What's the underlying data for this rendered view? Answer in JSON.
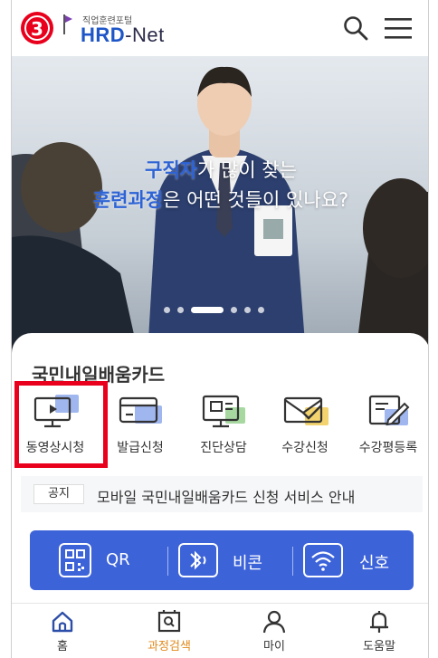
{
  "step_marker": "3",
  "header": {
    "logo_small": "직업훈련포털",
    "logo_hrd": "HRD",
    "logo_net": "-Net"
  },
  "hero": {
    "line1_highlight": "구직자",
    "line1_rest": "가 많이 찾는",
    "line2_highlight": "훈련과정",
    "line2_rest": "은 어떤 것들이 있나요?",
    "slide_count": 6,
    "active_slide": 3
  },
  "card_section": {
    "title": "국민내일배움카드",
    "items": [
      {
        "label": "동영상시청",
        "icon": "monitor-play-icon"
      },
      {
        "label": "발급신청",
        "icon": "card-icon"
      },
      {
        "label": "진단상담",
        "icon": "consult-monitor-icon"
      },
      {
        "label": "수강신청",
        "icon": "check-envelope-icon"
      },
      {
        "label": "수강평등록",
        "icon": "edit-review-icon"
      }
    ]
  },
  "notice": {
    "badge": "공지",
    "text": "모바일 국민내일배움카드 신청 서비스 안내"
  },
  "auth": {
    "items": [
      {
        "label": "QR",
        "icon": "qr-icon"
      },
      {
        "label": "비콘",
        "icon": "bluetooth-icon"
      },
      {
        "label": "신호",
        "icon": "wifi-icon"
      }
    ]
  },
  "bottom_nav": {
    "items": [
      {
        "label": "홈",
        "icon": "home-icon"
      },
      {
        "label": "과정검색",
        "icon": "course-search-icon"
      },
      {
        "label": "마이",
        "icon": "person-icon"
      },
      {
        "label": "도움말",
        "icon": "bell-icon"
      }
    ],
    "active_label": "과정검색"
  },
  "colors": {
    "brand_blue": "#3d63d9",
    "highlight_red": "#e8001c",
    "active_nav": "#e08a1e"
  }
}
